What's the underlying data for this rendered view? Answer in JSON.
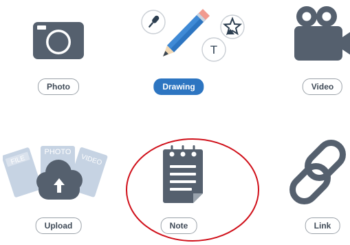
{
  "options": [
    {
      "id": "photo",
      "label": "Photo",
      "icon": "camera-icon",
      "selected": false
    },
    {
      "id": "drawing",
      "label": "Drawing",
      "icon": "pencil-icon",
      "selected": true
    },
    {
      "id": "video",
      "label": "Video",
      "icon": "video-camera-icon",
      "selected": false
    },
    {
      "id": "upload",
      "label": "Upload",
      "icon": "upload-cloud-icon",
      "selected": false
    },
    {
      "id": "note",
      "label": "Note",
      "icon": "notepad-icon",
      "selected": false
    },
    {
      "id": "link",
      "label": "Link",
      "icon": "chain-link-icon",
      "selected": false
    }
  ],
  "upload_file_cards": [
    "FILE",
    "PHOTO",
    "VIDEO"
  ],
  "drawing_badges": [
    "microphone-icon",
    "shapes-star-icon",
    "text-t-icon"
  ],
  "drawing_badge_text": "T",
  "colors": {
    "icon_gray": "#55606e",
    "accent_blue": "#2d75c1",
    "pencil_tip": "#f2d8b3",
    "pencil_eraser": "#f19a8f",
    "upload_cards": "#c6d3e3",
    "highlight_ring": "#d0101a"
  }
}
